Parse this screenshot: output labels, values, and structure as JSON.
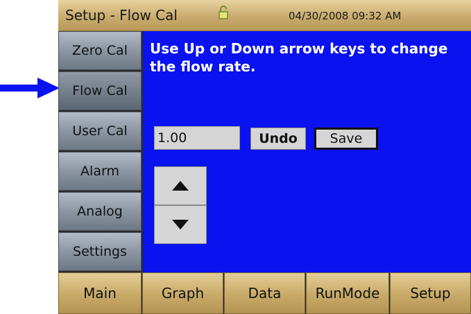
{
  "title_bar": {
    "title": "Setup - Flow Cal",
    "datetime": "04/30/2008 09:32 AM",
    "lock_icon": "unlocked-padlock-icon"
  },
  "sidebar": {
    "items": [
      {
        "label": "Zero Cal"
      },
      {
        "label": "Flow Cal",
        "active": true
      },
      {
        "label": "User Cal"
      },
      {
        "label": "Alarm"
      },
      {
        "label": "Analog"
      },
      {
        "label": "Settings"
      }
    ]
  },
  "main": {
    "instruction": "Use Up or Down arrow keys to change the flow rate.",
    "flow_value": "1.00",
    "undo_label": "Undo",
    "save_label": "Save",
    "up_icon": "up-triangle-icon",
    "down_icon": "down-triangle-icon"
  },
  "bottom_nav": {
    "tabs": [
      {
        "label": "Main"
      },
      {
        "label": "Graph"
      },
      {
        "label": "Data"
      },
      {
        "label": "RunMode"
      },
      {
        "label": "Setup"
      }
    ]
  },
  "annotation": {
    "pointer": "blue-right-arrow-icon",
    "color": "#0a12f0"
  },
  "colors": {
    "screen_blue": "#0a12f0",
    "title_bar_gold": "#c9ac6d",
    "sidebar_gray": "#8f9aa6"
  }
}
